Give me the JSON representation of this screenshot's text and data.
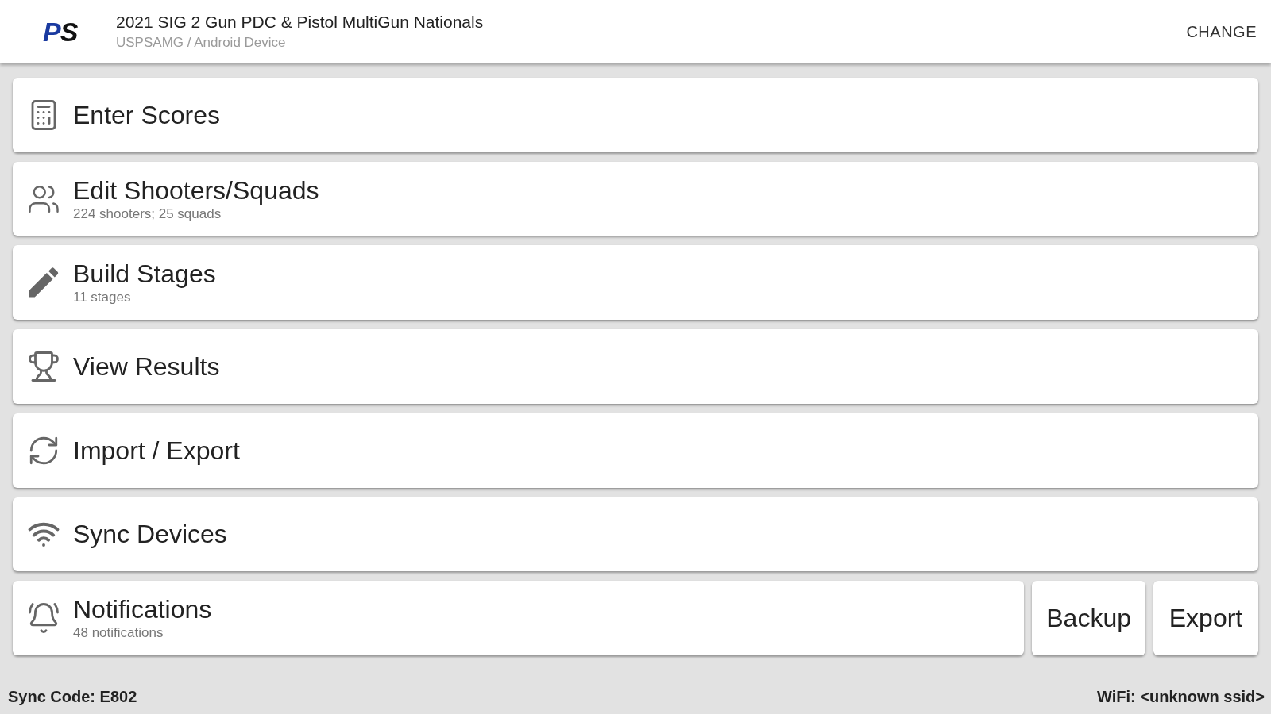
{
  "header": {
    "logo": "PS",
    "title": "2021 SIG 2 Gun PDC & Pistol MultiGun Nationals",
    "subtitle": "USPSAMG / Android Device",
    "action": "CHANGE"
  },
  "menu": [
    {
      "title": "Enter Scores"
    },
    {
      "title": "Edit Shooters/Squads",
      "subtitle": "224 shooters; 25 squads"
    },
    {
      "title": "Build Stages",
      "subtitle": "11 stages"
    },
    {
      "title": "View Results"
    },
    {
      "title": "Import / Export"
    },
    {
      "title": "Sync Devices"
    },
    {
      "title": "Notifications",
      "subtitle": "48 notifications"
    }
  ],
  "buttons": [
    "Backup",
    "Export"
  ],
  "status_bar": {
    "sync_code": "Sync Code: E802",
    "wifi": "WiFi: <unknown ssid>"
  }
}
